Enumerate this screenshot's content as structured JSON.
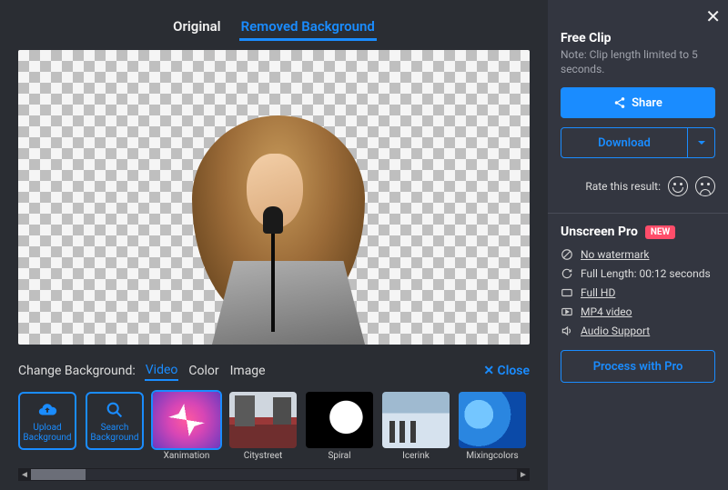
{
  "tabs": {
    "original": "Original",
    "removed": "Removed Background"
  },
  "bg": {
    "label": "Change Background:",
    "video": "Video",
    "color": "Color",
    "image": "Image",
    "close": "Close",
    "upload": "Upload Background",
    "search": "Search Background",
    "thumbs": {
      "xanimation": "Xanimation",
      "citystreet": "Citystreet",
      "spiral": "Spiral",
      "icerink": "Icerink",
      "mixingcolors": "Mixingcolors"
    }
  },
  "side": {
    "free_title": "Free Clip",
    "free_note": "Note: Clip length limited to 5 seconds.",
    "share": "Share",
    "download": "Download",
    "rate_label": "Rate this result:",
    "pro_title": "Unscreen Pro",
    "new_badge": "NEW",
    "features": {
      "no_watermark": "No watermark",
      "full_length": "Full Length: 00:12 seconds",
      "full_hd": "Full HD",
      "mp4": "MP4 video",
      "audio": "Audio Support"
    },
    "process": "Process with Pro"
  }
}
